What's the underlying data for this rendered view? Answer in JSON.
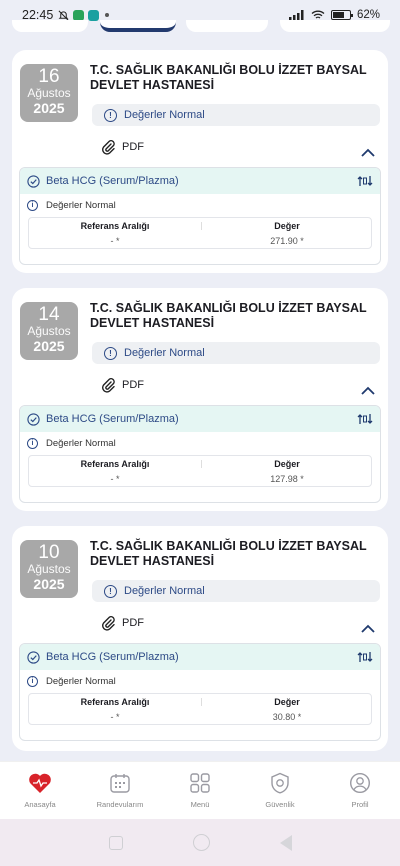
{
  "status_bar": {
    "time": "22:45",
    "battery": "62%"
  },
  "cards": [
    {
      "day": "16",
      "month": "Ağustos",
      "year": "2025",
      "hospital": "T.C. SAĞLIK BAKANLIĞI BOLU İZZET BAYSAL DEVLET HASTANESİ",
      "status": "Değerler Normal",
      "pdf_label": "PDF",
      "test_name": "Beta HCG (Serum/Plazma)",
      "note": "Değerler Normal",
      "ref_header": "Referans Aralığı",
      "value_header": "Değer",
      "ref_value": "- *",
      "value": "271.90 *"
    },
    {
      "day": "14",
      "month": "Ağustos",
      "year": "2025",
      "hospital": "T.C. SAĞLIK BAKANLIĞI BOLU İZZET BAYSAL DEVLET HASTANESİ",
      "status": "Değerler Normal",
      "pdf_label": "PDF",
      "test_name": "Beta HCG (Serum/Plazma)",
      "note": "Değerler Normal",
      "ref_header": "Referans Aralığı",
      "value_header": "Değer",
      "ref_value": "- *",
      "value": "127.98 *"
    },
    {
      "day": "10",
      "month": "Ağustos",
      "year": "2025",
      "hospital": "T.C. SAĞLIK BAKANLIĞI BOLU İZZET BAYSAL DEVLET HASTANESİ",
      "status": "Değerler Normal",
      "pdf_label": "PDF",
      "test_name": "Beta HCG (Serum/Plazma)",
      "note": "Değerler Normal",
      "ref_header": "Referans Aralığı",
      "value_header": "Değer",
      "ref_value": "- *",
      "value": "30.80 *"
    }
  ],
  "bottom_nav": [
    {
      "label": "Anasayfa",
      "icon": "heart-icon"
    },
    {
      "label": "Randevularım",
      "icon": "calendar-icon"
    },
    {
      "label": "Menü",
      "icon": "grid-icon"
    },
    {
      "label": "Güvenlik",
      "icon": "gear-shield-icon"
    },
    {
      "label": "Profil",
      "icon": "profile-icon"
    }
  ],
  "colors": {
    "accent": "#2d4a86",
    "result_header_bg": "#e5f6f3",
    "date_badge": "#a8a8a8",
    "brand_red": "#d8232a"
  }
}
